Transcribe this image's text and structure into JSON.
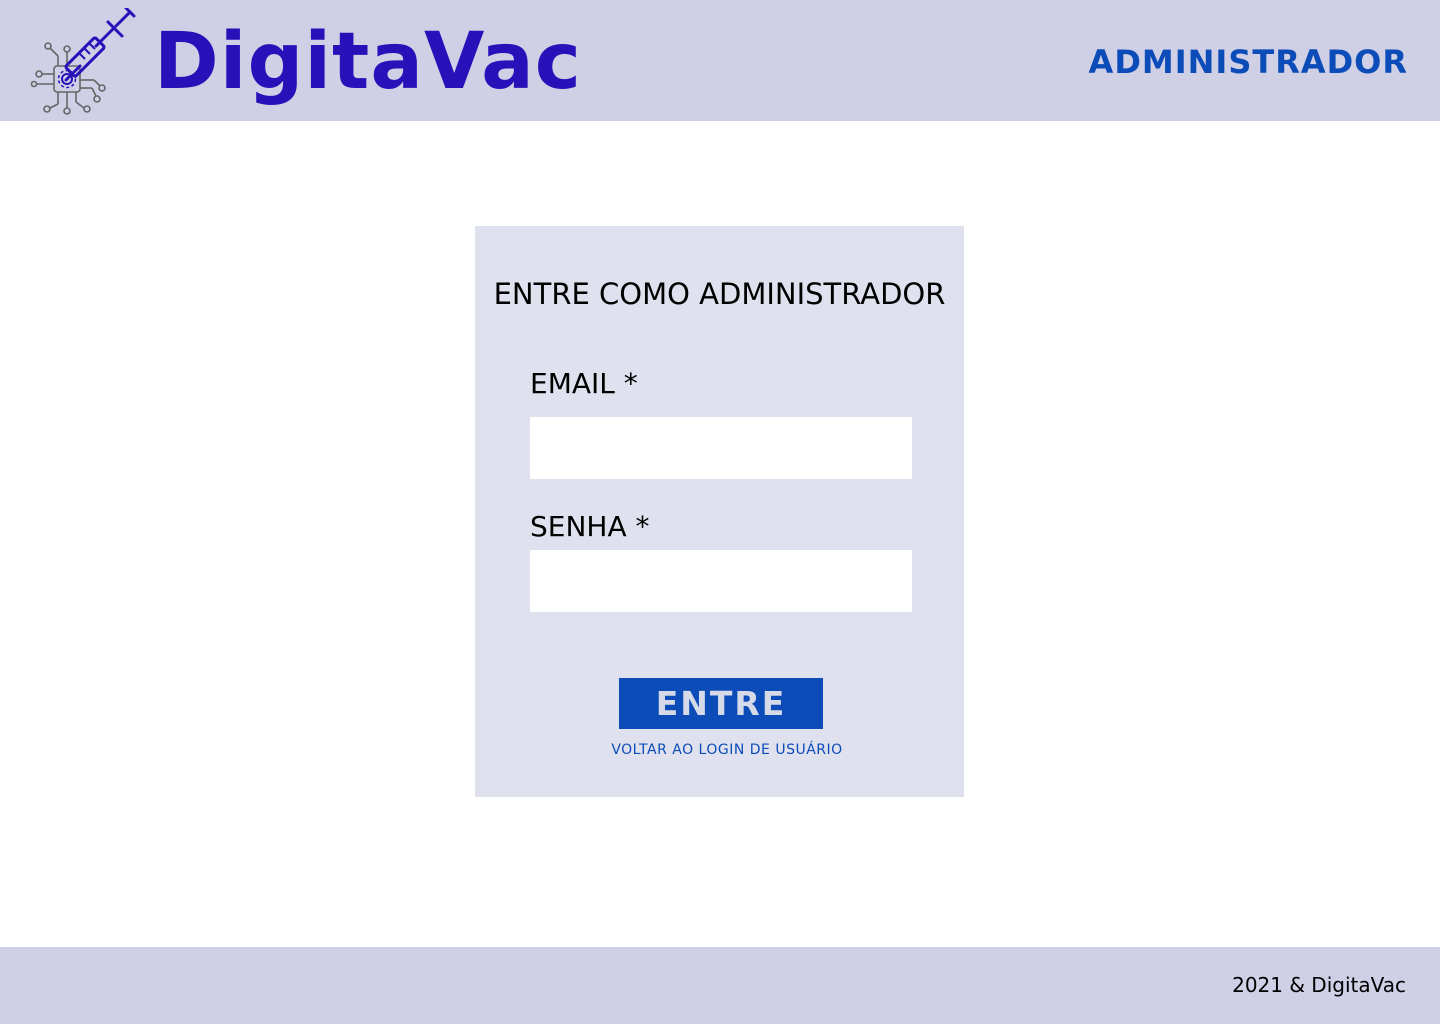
{
  "header": {
    "brand": "DigitaVac",
    "role": "ADMINISTRADOR",
    "logo_icon": "syringe-circuit-icon"
  },
  "login": {
    "title": "ENTRE COMO ADMINISTRADOR",
    "email_label": "EMAIL *",
    "email_value": "",
    "password_label": "SENHA *",
    "password_value": "",
    "submit_label": "ENTRE",
    "back_link": "VOLTAR AO LOGIN DE USUÁRIO"
  },
  "footer": {
    "copyright": "2021 & DigitaVac"
  },
  "colors": {
    "header_bg": "#cfcfe6",
    "card_bg": "#e0e1ef",
    "brand": "#2a10b8",
    "accent": "#0b4cb8"
  }
}
